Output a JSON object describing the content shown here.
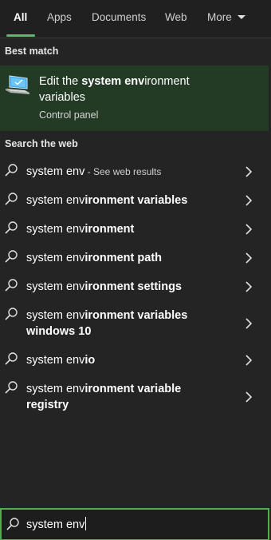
{
  "tabs": {
    "all": "All",
    "apps": "Apps",
    "documents": "Documents",
    "web": "Web",
    "more": "More"
  },
  "best_match": {
    "header": "Best match",
    "title_prefix": "Edit the ",
    "title_bold": "system env",
    "title_suffix": "ironment variables",
    "subtitle": "Control panel",
    "icon": "computer-settings-icon"
  },
  "web": {
    "header": "Search the web",
    "results": [
      {
        "typed": "system env",
        "rest": "",
        "suffix": " - See web results"
      },
      {
        "typed": "system env",
        "rest": "ironment variables",
        "suffix": ""
      },
      {
        "typed": "system env",
        "rest": "ironment",
        "suffix": ""
      },
      {
        "typed": "system env",
        "rest": "ironment path",
        "suffix": ""
      },
      {
        "typed": "system env",
        "rest": "ironment settings",
        "suffix": ""
      },
      {
        "typed": "system env",
        "rest": "ironment variables windows 10",
        "suffix": ""
      },
      {
        "typed": "system env",
        "rest": "io",
        "suffix": ""
      },
      {
        "typed": "system env",
        "rest": "ironment variable registry",
        "suffix": ""
      }
    ]
  },
  "search": {
    "value": "system env"
  },
  "colors": {
    "accent": "#4caf50",
    "best_match_bg": "#233a25",
    "background": "#242424"
  }
}
